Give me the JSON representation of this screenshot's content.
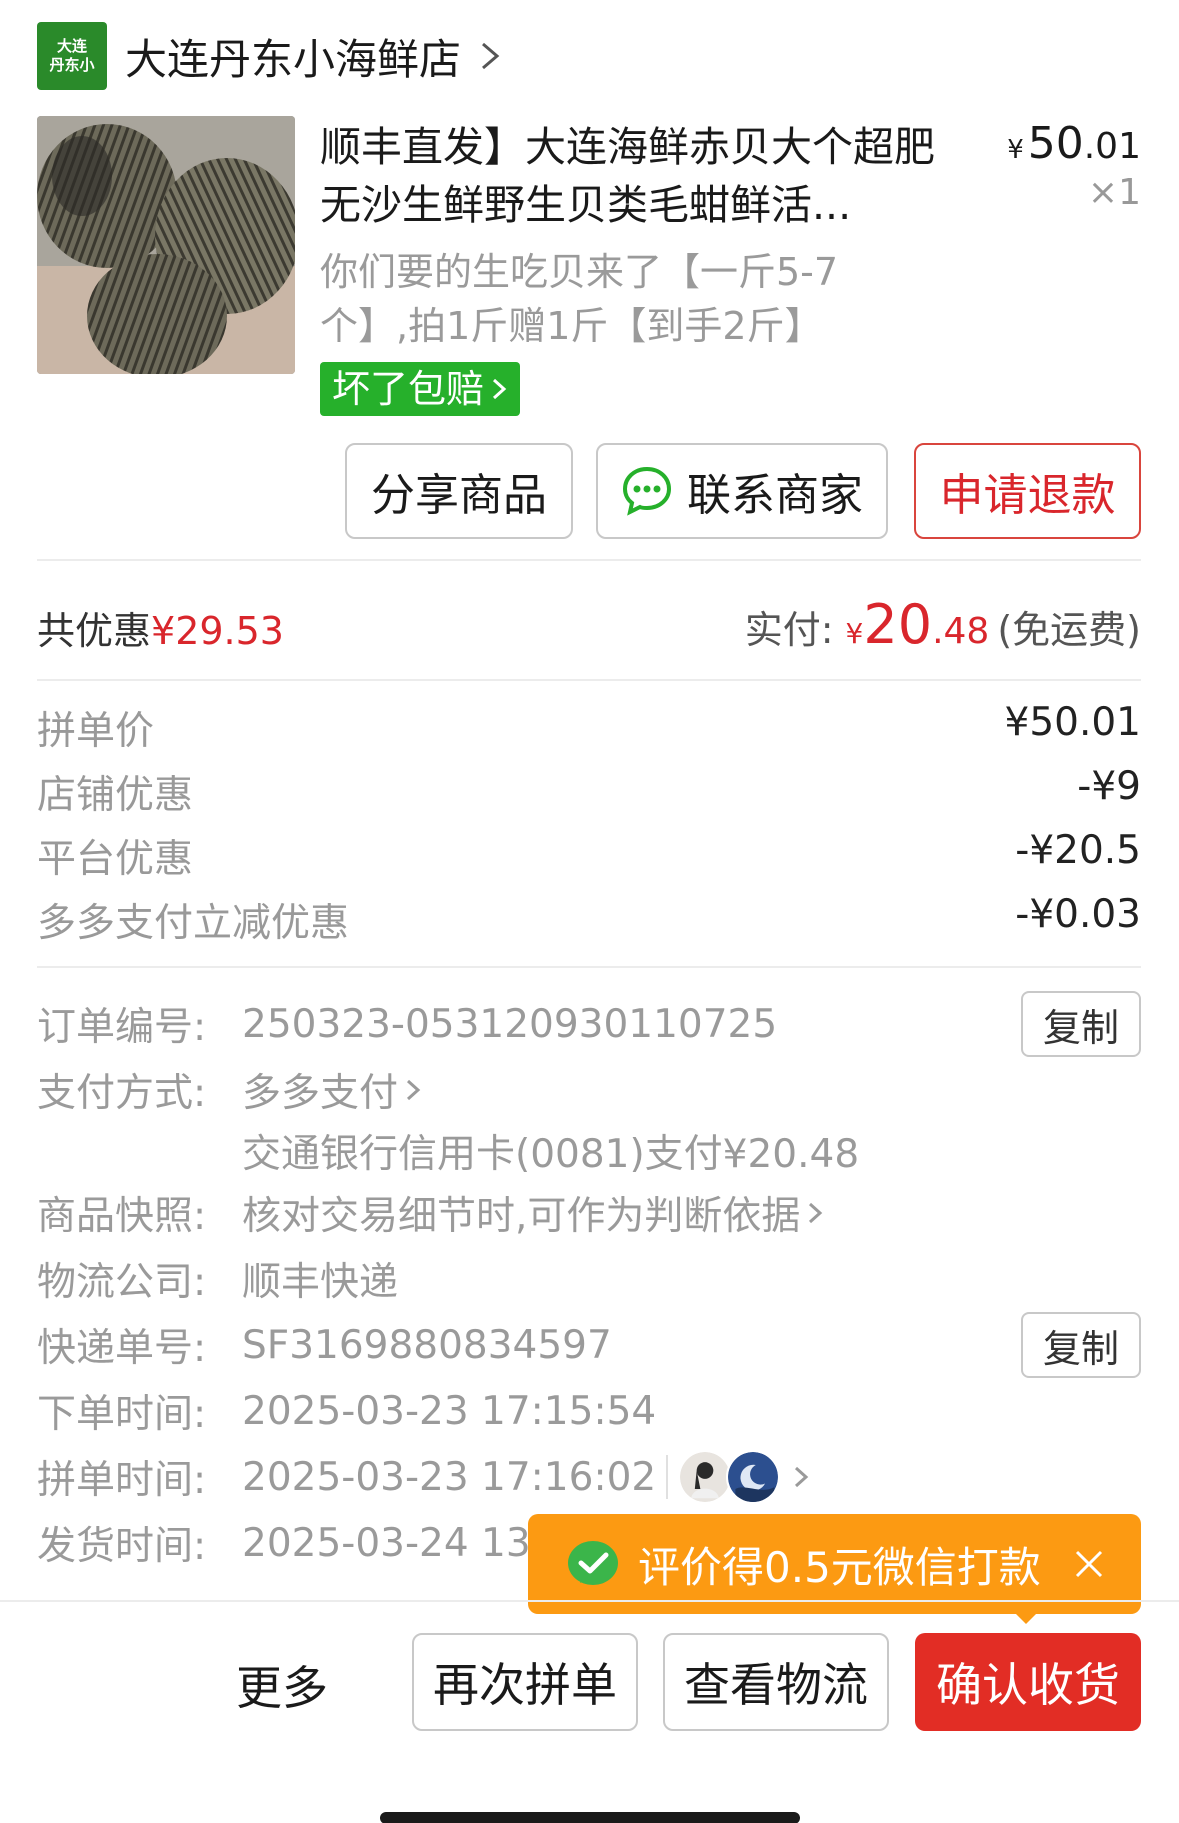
{
  "shop": {
    "logo_line1": "大连",
    "logo_line2": "丹东小",
    "name": "大连丹东小海鲜店"
  },
  "product": {
    "title": "顺丰直发】大连海鲜赤贝大个超肥无沙生鲜野生贝类毛蚶鲜活...",
    "price_currency": "¥",
    "price_int": "50",
    "price_dec": ".01",
    "quantity": "×1",
    "spec": "你们要的生吃贝来了【一斤5-7个】,拍1斤赠1斤【到手2斤】",
    "guarantee": "坏了包赔"
  },
  "actions": {
    "share": "分享商品",
    "contact": "联系商家",
    "refund": "申请退款"
  },
  "summary": {
    "savings_label": "共优惠",
    "savings_value": "¥29.53",
    "paid_label": "实付:",
    "paid_currency": "¥",
    "paid_int": "20",
    "paid_dec": ".48",
    "shipping": "(免运费)"
  },
  "price_breakdown": [
    {
      "label": "拼单价",
      "value": "¥50.01"
    },
    {
      "label": "店铺优惠",
      "value": "-¥9"
    },
    {
      "label": "平台优惠",
      "value": "-¥20.5"
    },
    {
      "label": "多多支付立减优惠",
      "value": "-¥0.03"
    }
  ],
  "order_info": {
    "order_no_label": "订单编号:",
    "order_no": "250323-053120930110725",
    "copy": "复制",
    "payment_label": "支付方式:",
    "payment_method": "多多支付",
    "payment_detail": "交通银行信用卡(0081)支付¥20.48",
    "snapshot_label": "商品快照:",
    "snapshot_value": "核对交易细节时,可作为判断依据",
    "courier_label": "物流公司:",
    "courier": "顺丰快递",
    "tracking_label": "快递单号:",
    "tracking_no": "SF3169880834597",
    "order_time_label": "下单时间:",
    "order_time": "2025-03-23 17:15:54",
    "group_time_label": "拼单时间:",
    "group_time": "2025-03-23 17:16:02",
    "ship_time_label": "发货时间:",
    "ship_time": "2025-03-24 13"
  },
  "toast": {
    "text": "评价得0.5元微信打款"
  },
  "bottom_bar": {
    "more": "更多",
    "reorder": "再次拼单",
    "logistics": "查看物流",
    "confirm": "确认收货"
  },
  "colors": {
    "brand_green": "#26b02b",
    "red": "#d9262c",
    "toast_orange": "#fc9a12",
    "confirm_red": "#e22d25"
  }
}
